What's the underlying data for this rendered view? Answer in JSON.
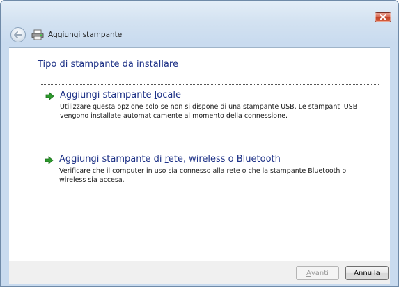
{
  "window": {
    "close_label": "Close"
  },
  "header": {
    "back_icon": "back-arrow-icon",
    "app_icon": "printer-icon",
    "title": "Aggiungi stampante"
  },
  "main": {
    "heading": "Tipo di stampante da installare",
    "options": [
      {
        "title_pre": "Aggiungi stampante ",
        "title_accel": "l",
        "title_post": "ocale",
        "description": "Utilizzare questa opzione solo se non si dispone di una stampante USB. Le stampanti USB vengono installate automaticamente al momento della connessione.",
        "icon": "green-arrow-icon"
      },
      {
        "title_pre": "Aggiungi stampante di ",
        "title_accel": "r",
        "title_post": "ete, wireless o Bluetooth",
        "description": "Verificare che il computer in uso sia connesso alla rete o che la stampante Bluetooth o wireless sia accesa.",
        "icon": "green-arrow-icon"
      }
    ]
  },
  "footer": {
    "next_label_accel": "A",
    "next_label_rest": "vanti",
    "cancel_label": "Annulla"
  },
  "colors": {
    "heading_blue": "#1e3287",
    "arrow_green": "#2d9a2d",
    "close_red": "#c2432a"
  }
}
